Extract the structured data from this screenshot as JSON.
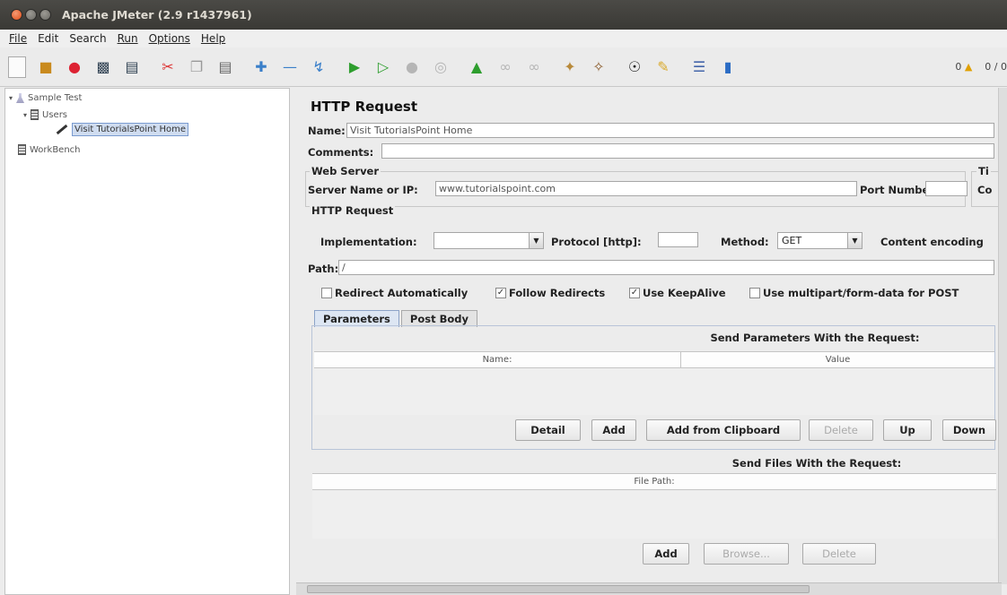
{
  "window": {
    "title": "Apache JMeter (2.9 r1437961)"
  },
  "menu": [
    "File",
    "Edit",
    "Search",
    "Run",
    "Options",
    "Help"
  ],
  "toolbar_status": {
    "warnings": "0",
    "threads": "0 / 0"
  },
  "tree": {
    "root": "Sample Test",
    "users": "Users",
    "sampler": "Visit TutorialsPoint Home",
    "workbench": "WorkBench"
  },
  "panel": {
    "header": "HTTP Request",
    "name_label": "Name:",
    "name_value": "Visit TutorialsPoint Home",
    "comments_label": "Comments:",
    "web_server_title": "Web Server",
    "timeouts_title": "Ti",
    "server_label": "Server Name or IP:",
    "server_value": "www.tutorialspoint.com",
    "port_label": "Port Number:",
    "connect_label": "Co",
    "http_request_title": "HTTP Request",
    "implementation_label": "Implementation:",
    "protocol_label": "Protocol [http]:",
    "method_label": "Method:",
    "method_value": "GET",
    "encoding_label": "Content encoding",
    "path_label": "Path:",
    "path_value": "/",
    "checkboxes": [
      {
        "label": "Redirect Automatically",
        "checked": false
      },
      {
        "label": "Follow Redirects",
        "checked": true
      },
      {
        "label": "Use KeepAlive",
        "checked": true
      },
      {
        "label": "Use multipart/form-data for POST",
        "checked": false
      }
    ],
    "tabs": [
      "Parameters",
      "Post Body"
    ],
    "params_title": "Send Parameters With the Request:",
    "params_columns": [
      "Name:",
      "Value"
    ],
    "params_buttons": {
      "detail": "Detail",
      "add": "Add",
      "clipboard": "Add from Clipboard",
      "delete": "Delete",
      "up": "Up",
      "down": "Down"
    },
    "files_title": "Send Files With the Request:",
    "files_column": "File Path:",
    "files_buttons": {
      "add": "Add",
      "browse": "Browse...",
      "delete": "Delete"
    }
  }
}
